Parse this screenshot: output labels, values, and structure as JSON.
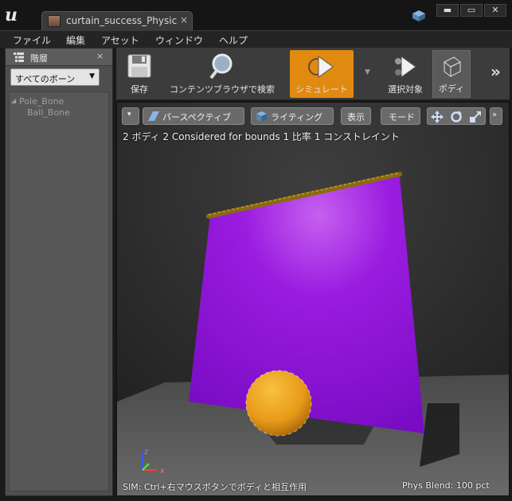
{
  "window": {
    "tab_label": "curtain_success_PhysicsA",
    "tab_close": "×",
    "minimize": "▬",
    "maximize": "▭",
    "close": "✕"
  },
  "menu": [
    "ファイル",
    "編集",
    "アセット",
    "ウィンドウ",
    "ヘルプ"
  ],
  "hierarchy": {
    "tab_label": "階層",
    "close": "×",
    "dropdown_value": "すべてのボーン",
    "tree": [
      {
        "label": "Pole_Bone",
        "expander": "◢"
      },
      {
        "label": "Ball_Bone"
      }
    ]
  },
  "toolbar": {
    "items": [
      {
        "label": "保存",
        "icon": "save-icon"
      },
      {
        "label": "コンテンツブラウザで検索",
        "icon": "magnifier-icon"
      },
      {
        "label": "シミュレート",
        "icon": "simulate-icon",
        "state": "active"
      },
      {
        "label": "選択対象",
        "icon": "selected-icon"
      },
      {
        "label": "ボディ",
        "icon": "body-icon",
        "state": "pressed"
      }
    ],
    "more": "»"
  },
  "viewport": {
    "buttons": {
      "menu": "▾",
      "perspective": "パースペクティブ",
      "lighting": "ライティング",
      "show": "表示",
      "mode": "モード",
      "more": "»"
    },
    "stats": "2 ボディ 2 Considered for bounds 1 比率 1 コンストレイント",
    "status_left": "SIM: Ctrl+右マウスボタンでボディと相互作用",
    "status_right": "Phys Blend: 100 pct",
    "axis": {
      "z": "z",
      "x": "x"
    },
    "colors": {
      "accent": "#e08a10",
      "curtain": "#9a1ce0",
      "ball": "#e8a020",
      "pole": "#8a6a10"
    }
  }
}
